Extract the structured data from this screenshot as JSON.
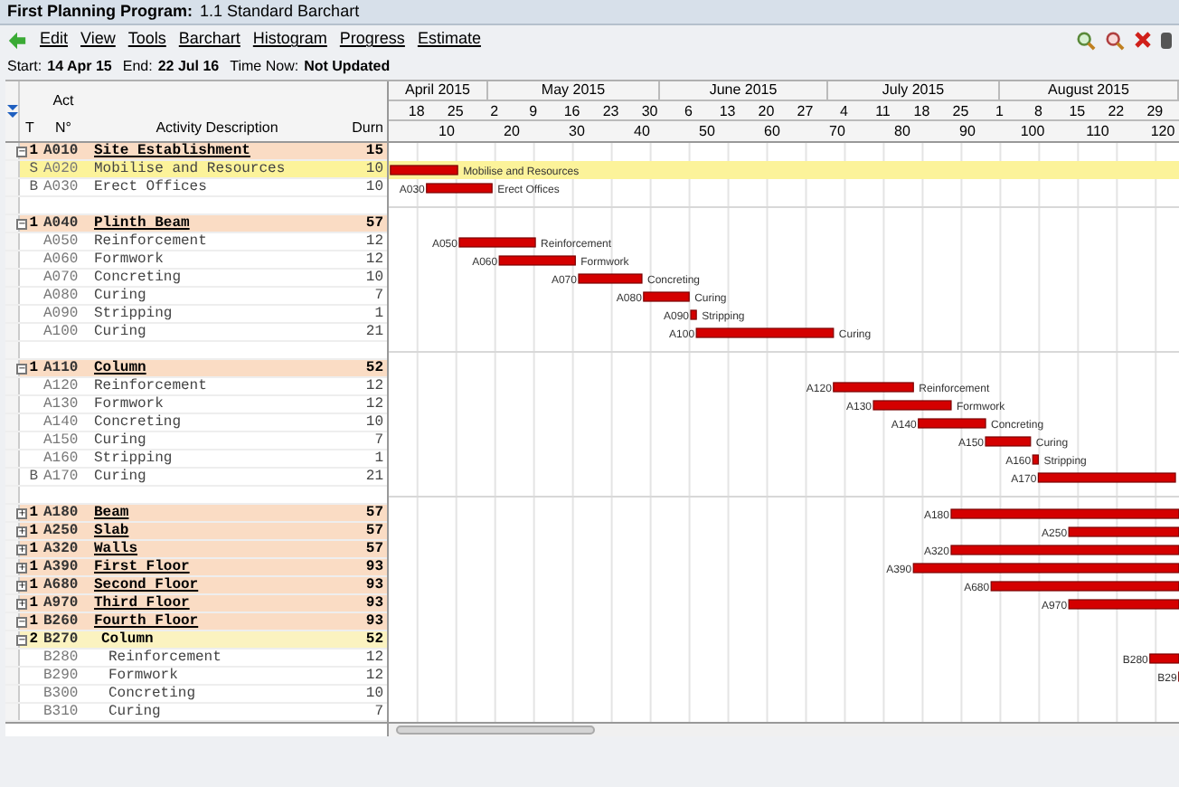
{
  "window": {
    "title_bold": "First Planning Program:",
    "title": "1.1 Standard Barchart"
  },
  "menu": [
    "Edit",
    "View",
    "Tools",
    "Barchart",
    "Histogram",
    "Progress",
    "Estimate"
  ],
  "info": {
    "start_label": "Start:",
    "start": "14 Apr 15",
    "end_label": "End:",
    "end": "22 Jul 16",
    "now_label": "Time Now:",
    "now": "Not Updated"
  },
  "columns": {
    "type": "T",
    "act_1": "Act",
    "act_2": "N°",
    "desc": "Activity Description",
    "durn": "Durn"
  },
  "timeline": {
    "months": [
      "April 2015",
      "May 2015",
      "June 2015",
      "July 2015",
      "August 2015"
    ],
    "weeks": [
      "18",
      "25",
      "2",
      "9",
      "16",
      "23",
      "30",
      "6",
      "13",
      "20",
      "27",
      "4",
      "11",
      "18",
      "25",
      "1",
      "8",
      "15",
      "22",
      "29"
    ],
    "units": [
      "10",
      "20",
      "30",
      "40",
      "50",
      "60",
      "70",
      "80",
      "90",
      "100",
      "110",
      "120"
    ]
  },
  "rows": [
    {
      "kind": "summary",
      "toggle": "−",
      "type": "1",
      "act": "A010",
      "desc": "Site Establishment",
      "durn": "15",
      "selected": false
    },
    {
      "kind": "activity",
      "type": "S",
      "act": "A020",
      "desc": "Mobilise and Resources",
      "durn": "10",
      "selected": true,
      "bar": {
        "label_right": "Mobilise and Resources"
      }
    },
    {
      "kind": "activity",
      "type": "B",
      "act": "A030",
      "desc": "Erect Offices",
      "durn": "10",
      "selected": false,
      "bar": {
        "label_left": "A030",
        "label_right": "Erect Offices"
      }
    },
    {
      "kind": "blank"
    },
    {
      "kind": "summary",
      "toggle": "−",
      "type": "1",
      "act": "A040",
      "desc": "Plinth Beam",
      "durn": "57",
      "selected": false
    },
    {
      "kind": "activity",
      "act": "A050",
      "desc": "Reinforcement",
      "durn": "12",
      "selected": false,
      "bar": {
        "label_left": "A050",
        "label_right": "Reinforcement"
      }
    },
    {
      "kind": "activity",
      "act": "A060",
      "desc": "Formwork",
      "durn": "12",
      "selected": false,
      "bar": {
        "label_left": "A060",
        "label_right": "Formwork"
      }
    },
    {
      "kind": "activity",
      "act": "A070",
      "desc": "Concreting",
      "durn": "10",
      "selected": false,
      "bar": {
        "label_left": "A070",
        "label_right": "Concreting"
      }
    },
    {
      "kind": "activity",
      "act": "A080",
      "desc": "Curing",
      "durn": "7",
      "selected": false,
      "bar": {
        "label_left": "A080",
        "label_right": "Curing"
      }
    },
    {
      "kind": "activity",
      "act": "A090",
      "desc": "Stripping",
      "durn": "1",
      "selected": false,
      "bar": {
        "label_left": "A090",
        "label_right": "Stripping"
      }
    },
    {
      "kind": "activity",
      "act": "A100",
      "desc": "Curing",
      "durn": "21",
      "selected": false,
      "bar": {
        "label_left": "A100",
        "label_right": "Curing"
      }
    },
    {
      "kind": "blank"
    },
    {
      "kind": "summary",
      "toggle": "−",
      "type": "1",
      "act": "A110",
      "desc": "Column",
      "durn": "52",
      "selected": false
    },
    {
      "kind": "activity",
      "act": "A120",
      "desc": "Reinforcement",
      "durn": "12",
      "selected": false,
      "bar": {
        "label_left": "A120",
        "label_right": "Reinforcement"
      }
    },
    {
      "kind": "activity",
      "act": "A130",
      "desc": "Formwork",
      "durn": "12",
      "selected": false,
      "bar": {
        "label_left": "A130",
        "label_right": "Formwork"
      }
    },
    {
      "kind": "activity",
      "act": "A140",
      "desc": "Concreting",
      "durn": "10",
      "selected": false,
      "bar": {
        "label_left": "A140",
        "label_right": "Concreting"
      }
    },
    {
      "kind": "activity",
      "act": "A150",
      "desc": "Curing",
      "durn": "7",
      "selected": false,
      "bar": {
        "label_left": "A150",
        "label_right": "Curing"
      }
    },
    {
      "kind": "activity",
      "act": "A160",
      "desc": "Stripping",
      "durn": "1",
      "selected": false,
      "bar": {
        "label_left": "A160",
        "label_right": "Stripping"
      }
    },
    {
      "kind": "activity",
      "type": "B",
      "act": "A170",
      "desc": "Curing",
      "durn": "21",
      "selected": false,
      "bar": {
        "label_left": "A170"
      }
    },
    {
      "kind": "blank"
    },
    {
      "kind": "summary",
      "toggle": "+",
      "type": "1",
      "act": "A180",
      "desc": "Beam",
      "durn": "57",
      "selected": false,
      "bar": {
        "label_left": "A180"
      }
    },
    {
      "kind": "summary",
      "toggle": "+",
      "type": "1",
      "act": "A250",
      "desc": "Slab",
      "durn": "57",
      "selected": false,
      "bar": {
        "label_left": "A250"
      }
    },
    {
      "kind": "summary",
      "toggle": "+",
      "type": "1",
      "act": "A320",
      "desc": "Walls",
      "durn": "57",
      "selected": false,
      "bar": {
        "label_left": "A320"
      }
    },
    {
      "kind": "summary",
      "toggle": "+",
      "type": "1",
      "act": "A390",
      "desc": "First Floor",
      "durn": "93",
      "selected": false,
      "bar": {
        "label_left": "A390"
      }
    },
    {
      "kind": "summary",
      "toggle": "+",
      "type": "1",
      "act": "A680",
      "desc": "Second Floor",
      "durn": "93",
      "selected": false,
      "bar": {
        "label_left": "A680"
      }
    },
    {
      "kind": "summary",
      "toggle": "+",
      "type": "1",
      "act": "A970",
      "desc": "Third Floor",
      "durn": "93",
      "selected": false,
      "bar": {
        "label_left": "A970"
      }
    },
    {
      "kind": "summary",
      "toggle": "−",
      "type": "1",
      "act": "B260",
      "desc": "Fourth Floor",
      "durn": "93",
      "selected": false
    },
    {
      "kind": "subsummary",
      "toggle": "−",
      "type": "2",
      "act": "B270",
      "desc": "Column",
      "durn": "52",
      "selected": false
    },
    {
      "kind": "activity",
      "act": "B280",
      "desc": "Reinforcement",
      "durn": "12",
      "selected": false,
      "bar": {
        "label_left": "B280"
      }
    },
    {
      "kind": "activity",
      "act": "B290",
      "desc": "Formwork",
      "durn": "12",
      "selected": false,
      "bar": {
        "label_left": "B29"
      }
    },
    {
      "kind": "activity",
      "act": "B300",
      "desc": "Concreting",
      "durn": "10",
      "selected": false
    },
    {
      "kind": "activity",
      "act": "B310",
      "desc": "Curing",
      "durn": "7",
      "selected": false
    }
  ]
}
